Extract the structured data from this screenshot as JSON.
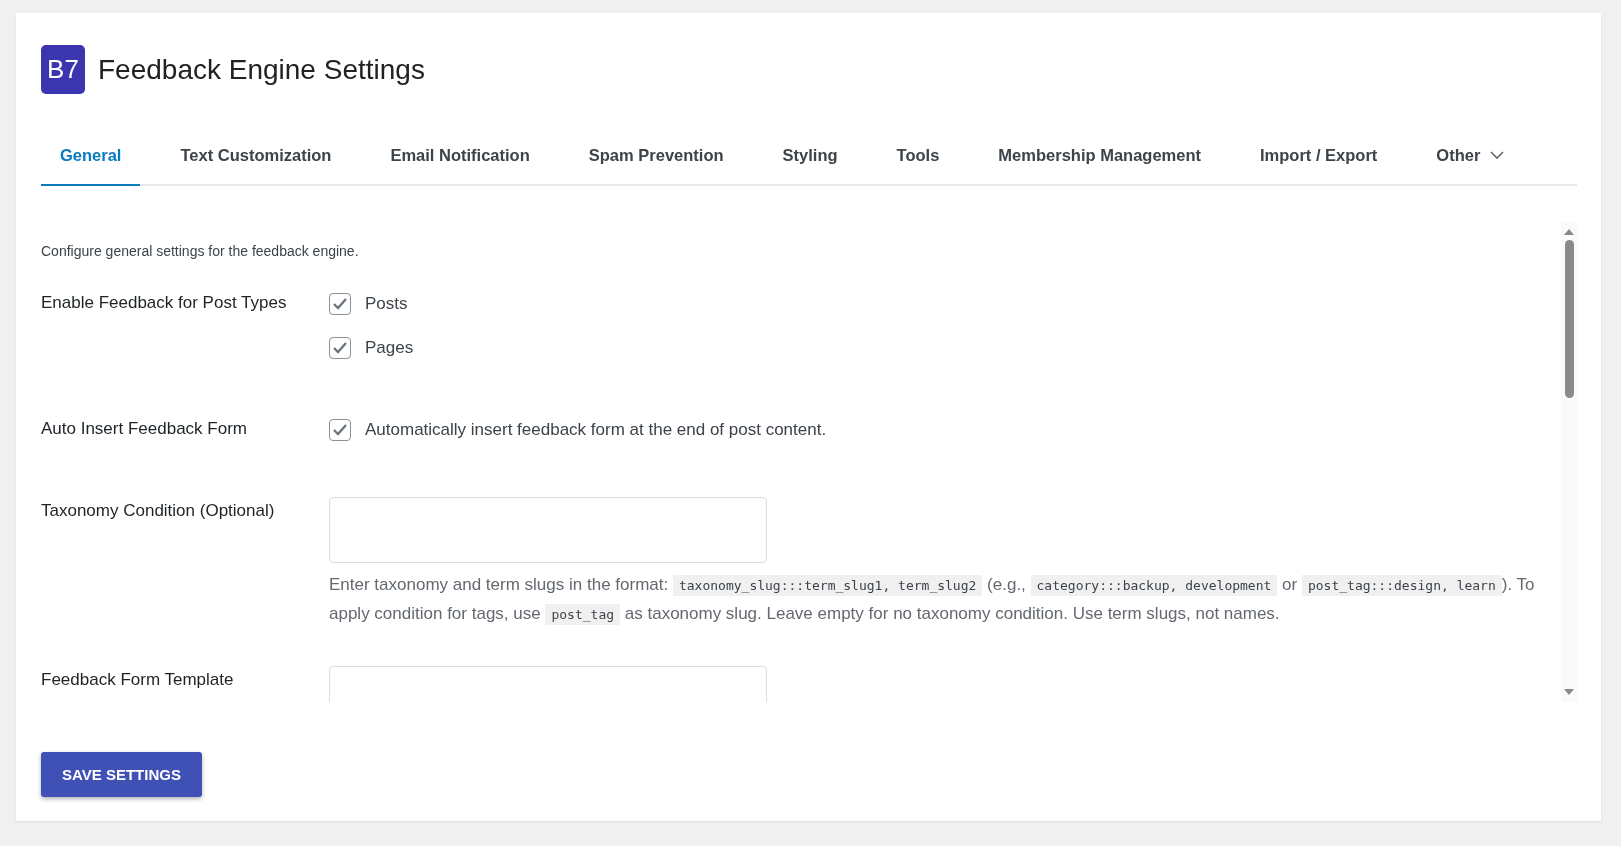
{
  "header": {
    "logo": "B7",
    "title": "Feedback Engine Settings"
  },
  "tabs": [
    {
      "label": "General",
      "selected": true
    },
    {
      "label": "Text Customization",
      "selected": false
    },
    {
      "label": "Email Notification",
      "selected": false
    },
    {
      "label": "Spam Prevention",
      "selected": false
    },
    {
      "label": "Styling",
      "selected": false
    },
    {
      "label": "Tools",
      "selected": false
    },
    {
      "label": "Membership Management",
      "selected": false
    },
    {
      "label": "Import / Export",
      "selected": false
    },
    {
      "label": "Other",
      "selected": false,
      "dropdown": true
    }
  ],
  "description": "Configure general settings for the feedback engine.",
  "settings": [
    {
      "kind": "checkboxes",
      "label": "Enable Feedback for Post Types",
      "options": [
        {
          "label": "Posts",
          "checked": true
        },
        {
          "label": "Pages",
          "checked": true
        }
      ]
    },
    {
      "kind": "checkboxes",
      "label": "Auto Insert Feedback Form",
      "options": [
        {
          "label": "Automatically insert feedback form at the end of post content.",
          "checked": true
        }
      ]
    },
    {
      "kind": "textarea",
      "label": "Taxonomy Condition (Optional)",
      "help": [
        {
          "kind": "text",
          "text": "Enter taxonomy and term slugs in the format: "
        },
        {
          "kind": "code",
          "text": "taxonomy_slug:::term_slug1, term_slug2"
        },
        {
          "kind": "text",
          "text": " (e.g., "
        },
        {
          "kind": "code",
          "text": "category:::backup, development"
        },
        {
          "kind": "text",
          "text": " or "
        },
        {
          "kind": "code",
          "text": "post_tag:::design, learn"
        },
        {
          "kind": "text",
          "text": "). To apply condition for tags, use "
        },
        {
          "kind": "code",
          "text": "post_tag"
        },
        {
          "kind": "text",
          "text": " as taxonomy slug. Leave empty for no taxonomy condition. Use term slugs, not names."
        }
      ]
    },
    {
      "kind": "textarea",
      "label": "Feedback Form Template"
    }
  ],
  "save_button": "SAVE SETTINGS"
}
